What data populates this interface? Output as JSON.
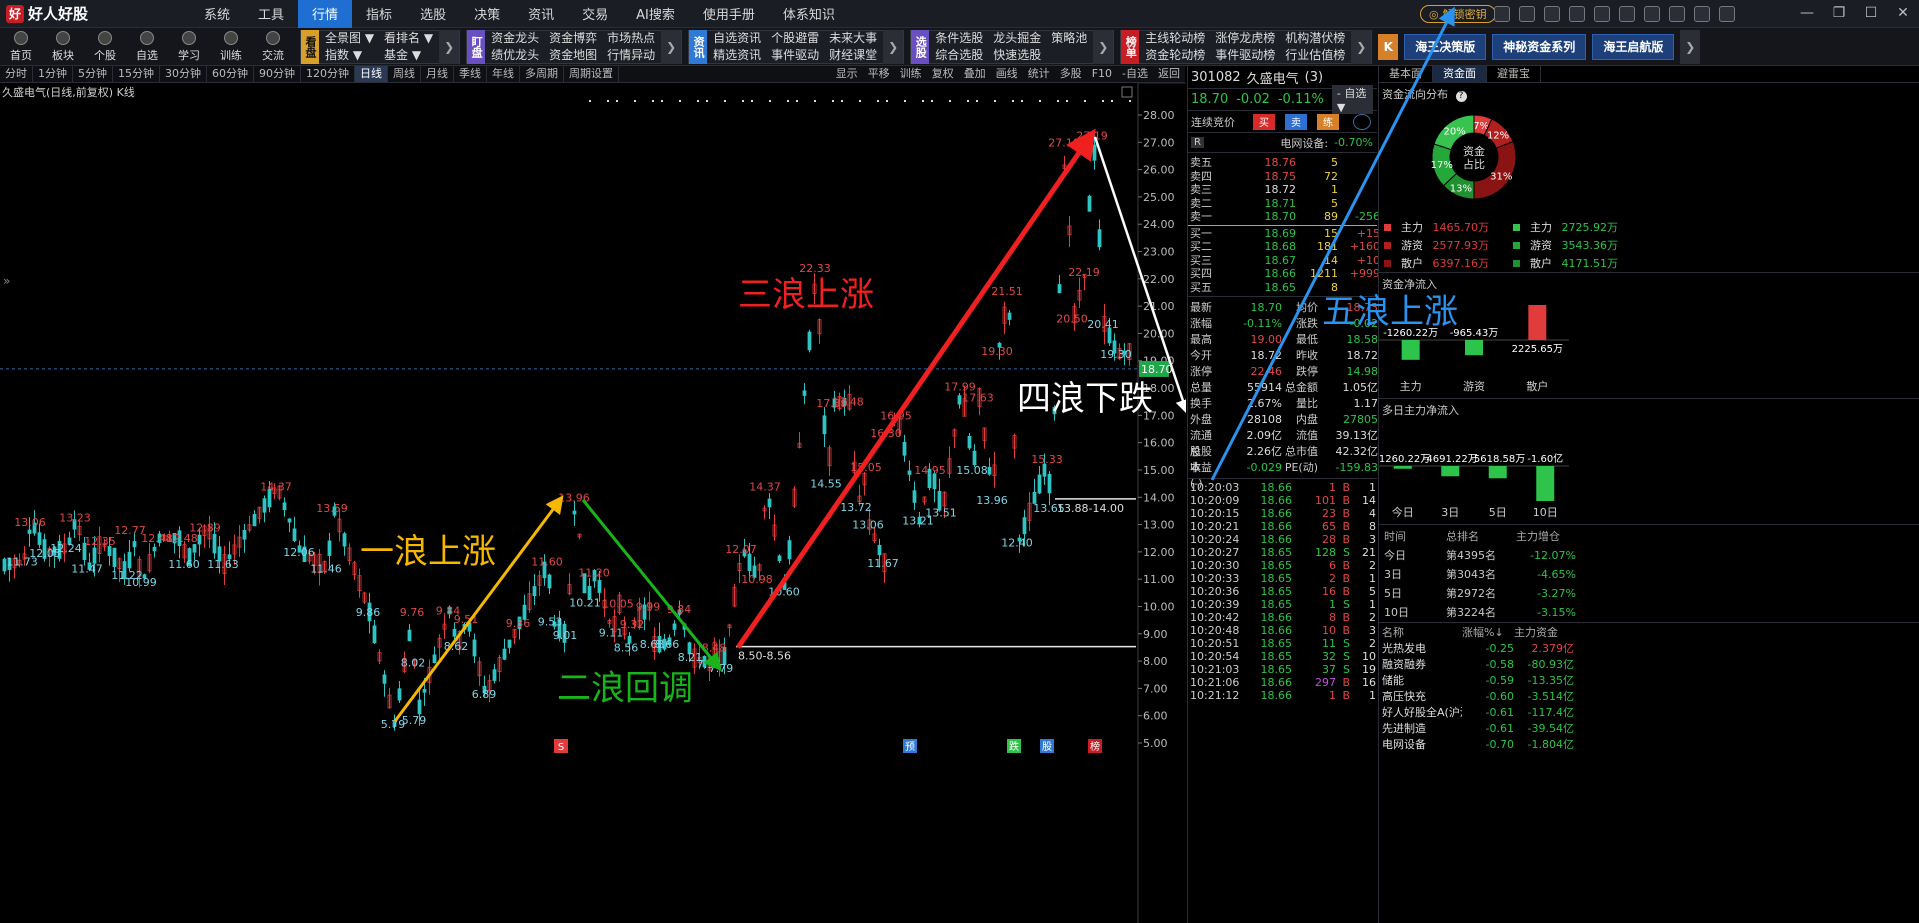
{
  "app": {
    "logo_mark": "好",
    "name": "好人好股",
    "menu": [
      "系统",
      "工具",
      "行情",
      "指标",
      "选股",
      "决策",
      "资讯",
      "交易",
      "AI搜索",
      "使用手册",
      "体系知识"
    ],
    "active_menu": "行情",
    "unlock_label": "解锁密钥"
  },
  "toolbar": {
    "buttons": [
      "首页",
      "板块",
      "个股",
      "自选",
      "学习",
      "训练",
      "交流"
    ],
    "groups": [
      {
        "tag": "看盘",
        "tag_color": "#d6a02a",
        "items": [
          "全景图 ▼",
          "指数 ▼",
          "看排名 ▼",
          "基金 ▼"
        ]
      },
      {
        "tag": "盯盘",
        "tag_color": "#6a4fc0",
        "items": [
          "资金龙头",
          "绩优龙头",
          "资金博弈",
          "资金地图",
          "市场热点",
          "行情异动"
        ]
      },
      {
        "tag": "资讯",
        "tag_color": "#2f7ad6",
        "items": [
          "自选资讯",
          "精选资讯",
          "个股避雷",
          "事件驱动",
          "未来大事",
          "财经课堂"
        ]
      },
      {
        "tag": "选股",
        "tag_color": "#6a4fc0",
        "items": [
          "条件选股",
          "综合选股",
          "龙头掘金",
          "快速选股",
          "策略池"
        ]
      },
      {
        "tag": "榜单",
        "tag_color": "#c81d25",
        "items": [
          "主线轮动榜",
          "资金轮动榜",
          "涨停龙虎榜",
          "事件驱动榜",
          "机构潜伏榜",
          "行业估值榜"
        ]
      }
    ],
    "brand_buttons": [
      "海王决策版",
      "神秘资金系列",
      "海王启航版"
    ]
  },
  "period_bar": {
    "periods": [
      "分时",
      "1分钟",
      "5分钟",
      "15分钟",
      "30分钟",
      "60分钟",
      "90分钟",
      "120分钟",
      "日线",
      "周线",
      "月线",
      "季线",
      "年线",
      "多周期",
      "周期设置"
    ],
    "active": "日线",
    "tools": [
      "显示",
      "平移",
      "训练",
      "复权",
      "叠加",
      "画线",
      "统计",
      "多股",
      "F10",
      "-自选",
      "返回"
    ]
  },
  "chart_title": "久盛电气(日线,前复权) K线",
  "chart_data": {
    "type": "candlestick",
    "y_ticks": [
      "28.00",
      "27.00",
      "26.00",
      "25.00",
      "24.00",
      "23.00",
      "22.00",
      "21.00",
      "20.00",
      "19.00",
      "18.00",
      "17.00",
      "16.00",
      "15.00",
      "14.00",
      "13.00",
      "12.00",
      "11.00",
      "10.00",
      "9.00",
      "8.00",
      "7.00",
      "6.00",
      "5.00"
    ],
    "ylim": [
      5,
      28
    ],
    "current_price": "18.70",
    "price_labels": [
      {
        "text": "13.06",
        "x": 30,
        "y": 13.1,
        "c": "r"
      },
      {
        "text": "13.23",
        "x": 75,
        "y": 13.25,
        "c": "r"
      },
      {
        "text": "12.35",
        "x": 100,
        "y": 12.4,
        "c": "r"
      },
      {
        "text": "12.77",
        "x": 130,
        "y": 12.8,
        "c": "r"
      },
      {
        "text": "12.48",
        "x": 157,
        "y": 12.5,
        "c": "r"
      },
      {
        "text": "12.48",
        "x": 182,
        "y": 12.5,
        "c": "r"
      },
      {
        "text": "12.89",
        "x": 205,
        "y": 12.9,
        "c": "r"
      },
      {
        "text": "14.37",
        "x": 276,
        "y": 14.4,
        "c": "r"
      },
      {
        "text": "13.59",
        "x": 332,
        "y": 13.6,
        "c": "r"
      },
      {
        "text": "11.73",
        "x": 22,
        "y": 11.65,
        "c": "c"
      },
      {
        "text": "12.05",
        "x": 45,
        "y": 11.95,
        "c": "c"
      },
      {
        "text": "12.24",
        "x": 66,
        "y": 12.15,
        "c": "c"
      },
      {
        "text": "11.47",
        "x": 87,
        "y": 11.4,
        "c": "c"
      },
      {
        "text": "11.22",
        "x": 127,
        "y": 11.15,
        "c": "c"
      },
      {
        "text": "10.99",
        "x": 141,
        "y": 10.9,
        "c": "c"
      },
      {
        "text": "11.60",
        "x": 184,
        "y": 11.55,
        "c": "c"
      },
      {
        "text": "11.63",
        "x": 223,
        "y": 11.55,
        "c": "c"
      },
      {
        "text": "12.06",
        "x": 299,
        "y": 12.0,
        "c": "c"
      },
      {
        "text": "11.46",
        "x": 326,
        "y": 11.4,
        "c": "c"
      },
      {
        "text": "9.86",
        "x": 368,
        "y": 9.8,
        "c": "c"
      },
      {
        "text": "8.02",
        "x": 413,
        "y": 7.95,
        "c": "c"
      },
      {
        "text": "9.76",
        "x": 412,
        "y": 9.8,
        "c": "r"
      },
      {
        "text": "9.84",
        "x": 448,
        "y": 9.85,
        "c": "r"
      },
      {
        "text": "9.51",
        "x": 466,
        "y": 9.55,
        "c": "r"
      },
      {
        "text": "8.62",
        "x": 456,
        "y": 8.55,
        "c": "c"
      },
      {
        "text": "9.36",
        "x": 518,
        "y": 9.4,
        "c": "r"
      },
      {
        "text": "9.53",
        "x": 550,
        "y": 9.45,
        "c": "c"
      },
      {
        "text": "6.89",
        "x": 484,
        "y": 6.8,
        "c": "c"
      },
      {
        "text": "5.79",
        "x": 393,
        "y": 5.7,
        "c": "c"
      },
      {
        "text": "5.79",
        "x": 414,
        "y": 5.85,
        "c": "c"
      },
      {
        "text": "11.60",
        "x": 547,
        "y": 11.65,
        "c": "r"
      },
      {
        "text": "13.96",
        "x": 574,
        "y": 14.0,
        "c": "r"
      },
      {
        "text": "11.20",
        "x": 594,
        "y": 11.25,
        "c": "r"
      },
      {
        "text": "10.21",
        "x": 585,
        "y": 10.15,
        "c": "c"
      },
      {
        "text": "9.01",
        "x": 565,
        "y": 8.95,
        "c": "c"
      },
      {
        "text": "10.05",
        "x": 618,
        "y": 10.1,
        "c": "r"
      },
      {
        "text": "9.99",
        "x": 648,
        "y": 10.0,
        "c": "r"
      },
      {
        "text": "9.84",
        "x": 679,
        "y": 9.9,
        "c": "r"
      },
      {
        "text": "9.32",
        "x": 632,
        "y": 9.35,
        "c": "r"
      },
      {
        "text": "9.11",
        "x": 611,
        "y": 9.05,
        "c": "c"
      },
      {
        "text": "8.56",
        "x": 626,
        "y": 8.5,
        "c": "c"
      },
      {
        "text": "8.68",
        "x": 652,
        "y": 8.62,
        "c": "c"
      },
      {
        "text": "8.66",
        "x": 667,
        "y": 8.62,
        "c": "c"
      },
      {
        "text": "8.48",
        "x": 714,
        "y": 8.5,
        "c": "r"
      },
      {
        "text": "8.21",
        "x": 690,
        "y": 8.15,
        "c": "c"
      },
      {
        "text": "7.96",
        "x": 709,
        "y": 7.9,
        "c": "c"
      },
      {
        "text": "7.79",
        "x": 721,
        "y": 7.75,
        "c": "c"
      },
      {
        "text": "12.07",
        "x": 741,
        "y": 12.1,
        "c": "r"
      },
      {
        "text": "14.37",
        "x": 765,
        "y": 14.4,
        "c": "r"
      },
      {
        "text": "10.98",
        "x": 757,
        "y": 11.0,
        "c": "r"
      },
      {
        "text": "10.60",
        "x": 784,
        "y": 10.55,
        "c": "c"
      },
      {
        "text": "22.33",
        "x": 815,
        "y": 22.4,
        "c": "r"
      },
      {
        "text": "17.39",
        "x": 832,
        "y": 17.45,
        "c": "r"
      },
      {
        "text": "17.48",
        "x": 848,
        "y": 17.5,
        "c": "r"
      },
      {
        "text": "14.55",
        "x": 826,
        "y": 14.5,
        "c": "c"
      },
      {
        "text": "15.05",
        "x": 866,
        "y": 15.1,
        "c": "r"
      },
      {
        "text": "13.72",
        "x": 856,
        "y": 13.65,
        "c": "c"
      },
      {
        "text": "13.06",
        "x": 868,
        "y": 13.0,
        "c": "c"
      },
      {
        "text": "11.67",
        "x": 883,
        "y": 11.6,
        "c": "c"
      },
      {
        "text": "16.95",
        "x": 896,
        "y": 17.0,
        "c": "r"
      },
      {
        "text": "16.30",
        "x": 886,
        "y": 16.35,
        "c": "r"
      },
      {
        "text": "14.95",
        "x": 930,
        "y": 15.0,
        "c": "r"
      },
      {
        "text": "13.21",
        "x": 918,
        "y": 13.15,
        "c": "c"
      },
      {
        "text": "17.99",
        "x": 960,
        "y": 18.05,
        "c": "r"
      },
      {
        "text": "17.63",
        "x": 978,
        "y": 17.65,
        "c": "r"
      },
      {
        "text": "15.08",
        "x": 972,
        "y": 15.0,
        "c": "c"
      },
      {
        "text": "13.51",
        "x": 941,
        "y": 13.45,
        "c": "c"
      },
      {
        "text": "19.30",
        "x": 997,
        "y": 19.35,
        "c": "r"
      },
      {
        "text": "21.51",
        "x": 1007,
        "y": 21.55,
        "c": "r"
      },
      {
        "text": "13.96",
        "x": 992,
        "y": 13.9,
        "c": "c"
      },
      {
        "text": "12.40",
        "x": 1017,
        "y": 12.35,
        "c": "c"
      },
      {
        "text": "15.33",
        "x": 1047,
        "y": 15.4,
        "c": "r"
      },
      {
        "text": "13.65",
        "x": 1049,
        "y": 13.6,
        "c": "c"
      },
      {
        "text": "20.50",
        "x": 1072,
        "y": 20.55,
        "c": "r"
      },
      {
        "text": "22.19",
        "x": 1084,
        "y": 22.25,
        "c": "r"
      },
      {
        "text": "27.19",
        "x": 1092,
        "y": 27.25,
        "c": "r"
      },
      {
        "text": "27.10",
        "x": 1064,
        "y": 27.0,
        "c": "r"
      },
      {
        "text": "20.41",
        "x": 1103,
        "y": 20.35,
        "c": "c"
      },
      {
        "text": "19.30",
        "x": 1116,
        "y": 19.25,
        "c": "c"
      }
    ],
    "support_lines": [
      {
        "label": "8.50-8.56",
        "x_start": 736,
        "y": 8.53
      },
      {
        "label": "13.88-14.00",
        "x_start": 1055,
        "y": 13.94
      }
    ],
    "waves": [
      {
        "label": "一浪上涨",
        "color": "#f5b700",
        "from": [
          395,
          5.8
        ],
        "to": [
          560,
          13.9
        ]
      },
      {
        "label": "二浪回调",
        "color": "#19b31a",
        "from": [
          583,
          13.9
        ],
        "to": [
          718,
          7.8
        ]
      },
      {
        "label": "三浪上涨",
        "color": "#f02020",
        "from": [
          738,
          8.5
        ],
        "to": [
          1090,
          27.2
        ]
      },
      {
        "label": "四浪下跌",
        "color": "#ffffff",
        "from": [
          1095,
          27.2
        ],
        "to": [
          1186,
          17.2
        ]
      },
      {
        "label": "五浪上涨",
        "color": "#2a93f0",
        "from": [
          1212,
          17.2
        ],
        "to": [
          1454,
          27.9
        ]
      }
    ],
    "bottom_markers": [
      {
        "text": "S",
        "x": 561,
        "c": "#e03c3c"
      },
      {
        "text": "预",
        "x": 910,
        "c": "#2f7ad6"
      },
      {
        "text": "跌",
        "x": 1014,
        "c": "#2ec34a"
      },
      {
        "text": "股",
        "x": 1047,
        "c": "#2f7ad6"
      },
      {
        "text": "榜",
        "x": 1095,
        "c": "#c81d25"
      }
    ]
  },
  "quote": {
    "code": "301082",
    "name": "久盛电气",
    "count": "(3)",
    "price": "18.70",
    "change": "-0.02",
    "change_pct": "-0.11%",
    "select": "- 自选 ▼",
    "auction_label": "连续竞价",
    "auction_buttons": [
      {
        "t": "买",
        "c": "#d62b2b"
      },
      {
        "t": "卖",
        "c": "#2f6fd2"
      },
      {
        "t": "练",
        "c": "#d6802a"
      }
    ],
    "sector_tag": "R",
    "sector_name": "电网设备:",
    "sector_change": "-0.70%",
    "asks": [
      {
        "l": "卖五",
        "p": "18.76",
        "q": "5",
        "d": ""
      },
      {
        "l": "卖四",
        "p": "18.75",
        "q": "72",
        "d": ""
      },
      {
        "l": "卖三",
        "p": "18.72",
        "q": "1",
        "d": ""
      },
      {
        "l": "卖二",
        "p": "18.71",
        "q": "5",
        "d": ""
      },
      {
        "l": "卖一",
        "p": "18.70",
        "q": "89",
        "d": "-256"
      }
    ],
    "bids": [
      {
        "l": "买一",
        "p": "18.69",
        "q": "15",
        "d": "+15"
      },
      {
        "l": "买二",
        "p": "18.68",
        "q": "181",
        "d": "+160"
      },
      {
        "l": "买三",
        "p": "18.67",
        "q": "14",
        "d": "+10"
      },
      {
        "l": "买四",
        "p": "18.66",
        "q": "1211",
        "d": "+999"
      },
      {
        "l": "买五",
        "p": "18.65",
        "q": "8",
        "d": ""
      }
    ],
    "stats": [
      [
        "最新",
        "18.70",
        "均价",
        "18.73"
      ],
      [
        "涨幅",
        "-0.11%",
        "涨跌",
        "-0.02"
      ],
      [
        "最高",
        "19.00",
        "最低",
        "18.58"
      ],
      [
        "今开",
        "18.72",
        "昨收",
        "18.72"
      ],
      [
        "涨停",
        "22.46",
        "跌停",
        "14.98"
      ],
      [
        "总量",
        "55914",
        "总金额",
        "1.05亿"
      ],
      [
        "换手",
        "2.67%",
        "量比",
        "1.17"
      ],
      [
        "外盘",
        "28108",
        "内盘",
        "27805"
      ],
      [
        "流通股",
        "2.09亿",
        "流值",
        "39.13亿"
      ],
      [
        "总股本",
        "2.26亿",
        "总市值",
        "42.32亿"
      ],
      [
        "收益(-)",
        "-0.029",
        "PE(动)",
        "-159.83"
      ]
    ],
    "ticks": [
      [
        "10:20:03",
        "18.66",
        "1",
        "B",
        "1"
      ],
      [
        "10:20:09",
        "18.66",
        "101",
        "B",
        "14"
      ],
      [
        "10:20:15",
        "18.66",
        "23",
        "B",
        "4"
      ],
      [
        "10:20:21",
        "18.66",
        "65",
        "B",
        "8"
      ],
      [
        "10:20:24",
        "18.66",
        "28",
        "B",
        "3"
      ],
      [
        "10:20:27",
        "18.65",
        "128",
        "S",
        "21"
      ],
      [
        "10:20:30",
        "18.65",
        "6",
        "B",
        "2"
      ],
      [
        "10:20:33",
        "18.65",
        "2",
        "B",
        "1"
      ],
      [
        "10:20:36",
        "18.65",
        "16",
        "B",
        "5"
      ],
      [
        "10:20:39",
        "18.65",
        "1",
        "S",
        "1"
      ],
      [
        "10:20:42",
        "18.66",
        "8",
        "B",
        "2"
      ],
      [
        "10:20:48",
        "18.66",
        "10",
        "B",
        "3"
      ],
      [
        "10:20:51",
        "18.65",
        "11",
        "S",
        "2"
      ],
      [
        "10:20:54",
        "18.65",
        "32",
        "S",
        "10"
      ],
      [
        "10:21:03",
        "18.65",
        "37",
        "S",
        "19"
      ],
      [
        "10:21:06",
        "18.66",
        "297",
        "B",
        "16"
      ],
      [
        "10:21:12",
        "18.66",
        "1",
        "B",
        "1"
      ]
    ]
  },
  "fund": {
    "tabs": [
      "基本面",
      "资金面",
      "避雷宝"
    ],
    "active_tab": "资金面",
    "flow_title": "资金流向分布",
    "donut_center": [
      "资金",
      "占比"
    ],
    "donut": [
      {
        "pct": "7%",
        "v": 7,
        "c": "#e03c3c"
      },
      {
        "pct": "12%",
        "v": 12,
        "c": "#b21f1f"
      },
      {
        "pct": "31%",
        "v": 31,
        "c": "#8a1414"
      },
      {
        "pct": "13%",
        "v": 13,
        "c": "#1f8f2f"
      },
      {
        "pct": "17%",
        "v": 17,
        "c": "#26a73a"
      },
      {
        "pct": "20%",
        "v": 20,
        "c": "#38c24e"
      }
    ],
    "legend": [
      {
        "sw1": "#e03c3c",
        "l1": "主力",
        "v1": "1465.70万",
        "sw2": "#38c24e",
        "l2": "主力",
        "v2": "2725.92万"
      },
      {
        "sw1": "#b21f1f",
        "l1": "游资",
        "v1": "2577.93万",
        "sw2": "#26a73a",
        "l2": "游资",
        "v2": "3543.36万"
      },
      {
        "sw1": "#8a1414",
        "l1": "散户",
        "v1": "6397.16万",
        "sw2": "#1f8f2f",
        "l2": "散户",
        "v2": "4171.51万"
      }
    ],
    "net_title": "资金净流入",
    "net": [
      {
        "label": "主力",
        "value": "-1260.22万",
        "v": -1260.22
      },
      {
        "label": "游资",
        "value": "-965.43万",
        "v": -965.43
      },
      {
        "label": "散户",
        "value": "2225.65万",
        "v": 2225.65
      }
    ],
    "multi_title": "多日主力净流入",
    "multi": [
      {
        "label": "今日",
        "value": "-1260.22万",
        "v": -1260.22
      },
      {
        "label": "3日",
        "value": "-4691.22万",
        "v": -4691.22
      },
      {
        "label": "5日",
        "value": "-5618.58万",
        "v": -5618.58
      },
      {
        "label": "10日",
        "value": "-1.60亿",
        "v": -16000
      }
    ],
    "rank_header": [
      "时间",
      "总排名",
      "主力增仓"
    ],
    "ranks": [
      [
        "今日",
        "第4395名",
        "-12.07%"
      ],
      [
        "3日",
        "第3043名",
        "-4.65%"
      ],
      [
        "5日",
        "第2972名",
        "-3.27%"
      ],
      [
        "10日",
        "第3224名",
        "-3.15%"
      ]
    ],
    "sector_header": [
      "名称",
      "涨幅%↓",
      "主力资金"
    ],
    "sectors": [
      [
        "光热发电",
        "-0.25",
        "2.379亿"
      ],
      [
        "融资融券",
        "-0.58",
        "-80.93亿"
      ],
      [
        "储能",
        "-0.59",
        "-13.35亿"
      ],
      [
        "高压快充",
        "-0.60",
        "-3.514亿"
      ],
      [
        "好人好股全A(沪深)",
        "-0.61",
        "-117.4亿"
      ],
      [
        "先进制造",
        "-0.61",
        "-39.54亿"
      ],
      [
        "电网设备",
        "-0.70",
        "-1.804亿"
      ]
    ]
  }
}
